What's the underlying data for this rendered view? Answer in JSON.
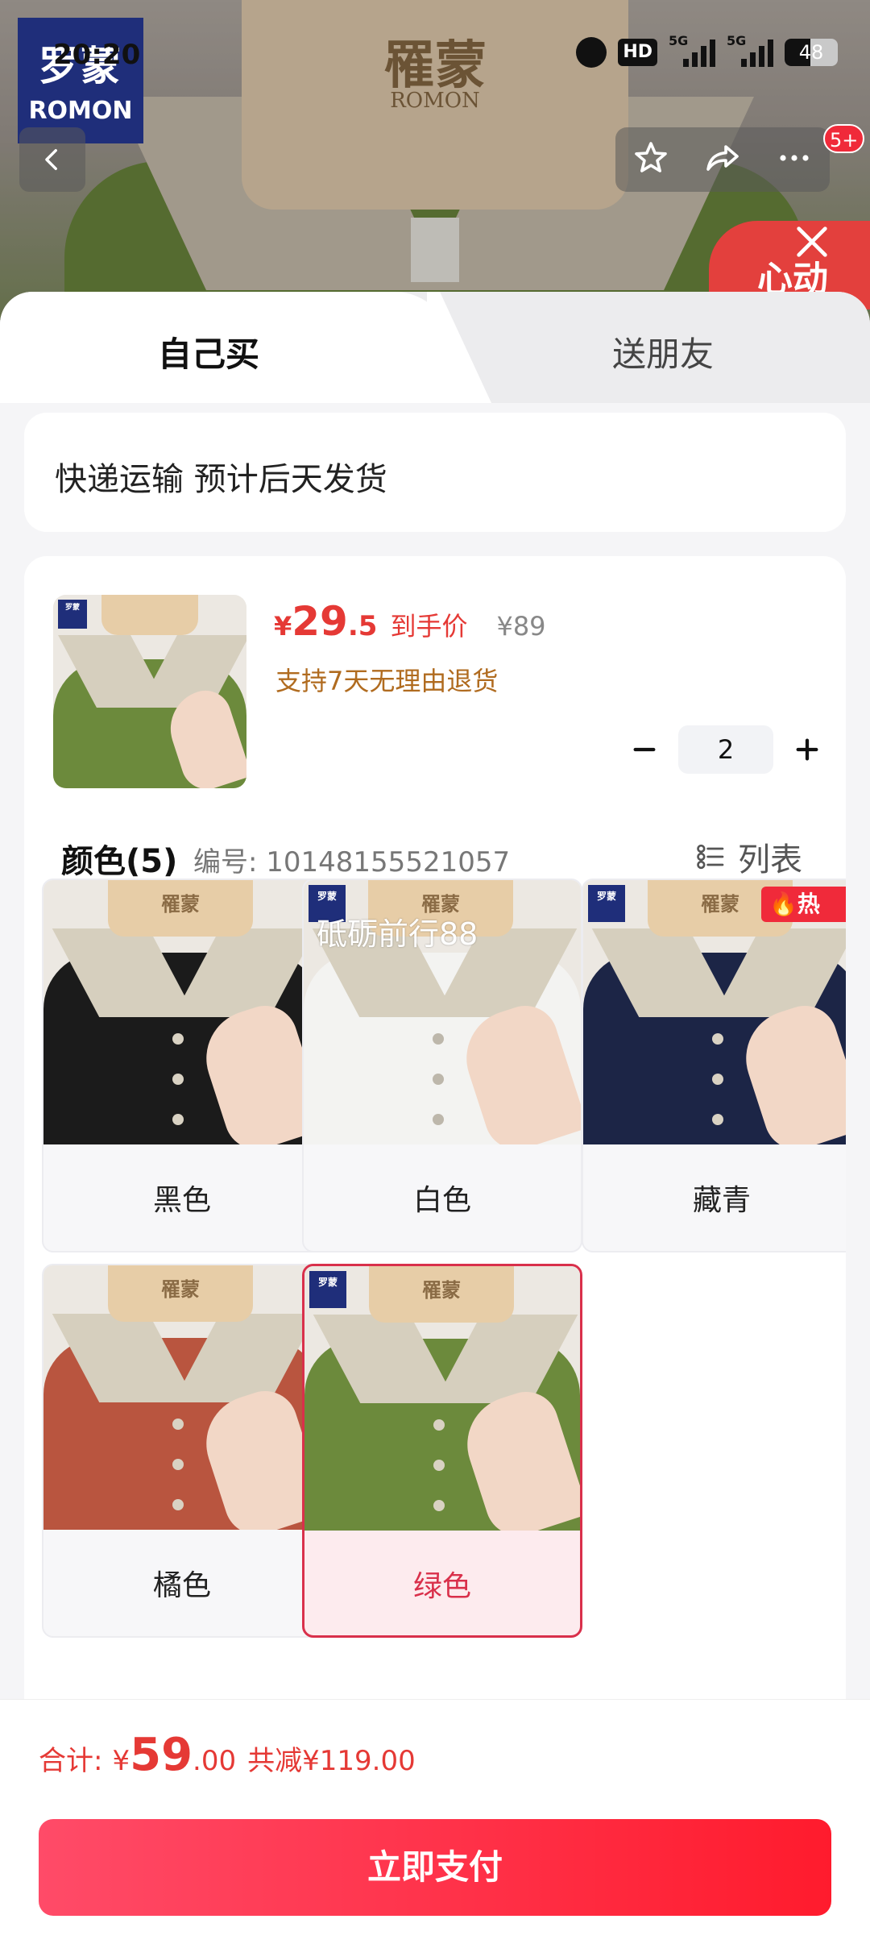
{
  "status_bar": {
    "time": "20:20",
    "hd_label": "HD",
    "signal1_label": "5G",
    "signal2_label": "5G",
    "battery": "48",
    "battery_level": 0.48
  },
  "header": {
    "brand_cn": "罗蒙",
    "brand_en": "ROMON",
    "hanger_cn": "罹蒙",
    "hanger_en": "ROMON",
    "notification_badge": "5+",
    "promo_tag": "心动"
  },
  "tabs": [
    {
      "label": "自己买",
      "active": true
    },
    {
      "label": "送朋友",
      "active": false
    }
  ],
  "shipping": {
    "text": "快递运输 预计后天发货"
  },
  "product": {
    "price_symbol": "¥",
    "price_int": "29",
    "price_dec": ".5",
    "price_tag": "到手价",
    "original_price": "¥89",
    "return_policy": "支持7天无理由退货",
    "quantity": "2"
  },
  "color_section": {
    "title": "颜色(5)",
    "code": "编号: 10148155521057",
    "list_label": "列表",
    "watermark": "砥砺前行88",
    "hot_label": "热",
    "options": [
      {
        "label": "黑色",
        "color": "#1b1b1b",
        "selected": false
      },
      {
        "label": "白色",
        "color": "#f3f3f1",
        "selected": false
      },
      {
        "label": "藏青",
        "color": "#1c2546",
        "selected": false
      },
      {
        "label": "橘色",
        "color": "#b9553f",
        "selected": false
      },
      {
        "label": "绿色",
        "color": "#6c8a3c",
        "selected": true
      }
    ]
  },
  "bottom_bar": {
    "total_label": "合计:",
    "total_symbol": "¥",
    "total_int": "59",
    "total_dec": ".00",
    "discount": "共减¥119.00",
    "pay_button": "立即支付"
  },
  "colors": {
    "accent": "#e53935",
    "selected_border": "#d9304b",
    "pay_gradient_start": "#ff4b68",
    "pay_gradient_end": "#ff1b2d"
  }
}
